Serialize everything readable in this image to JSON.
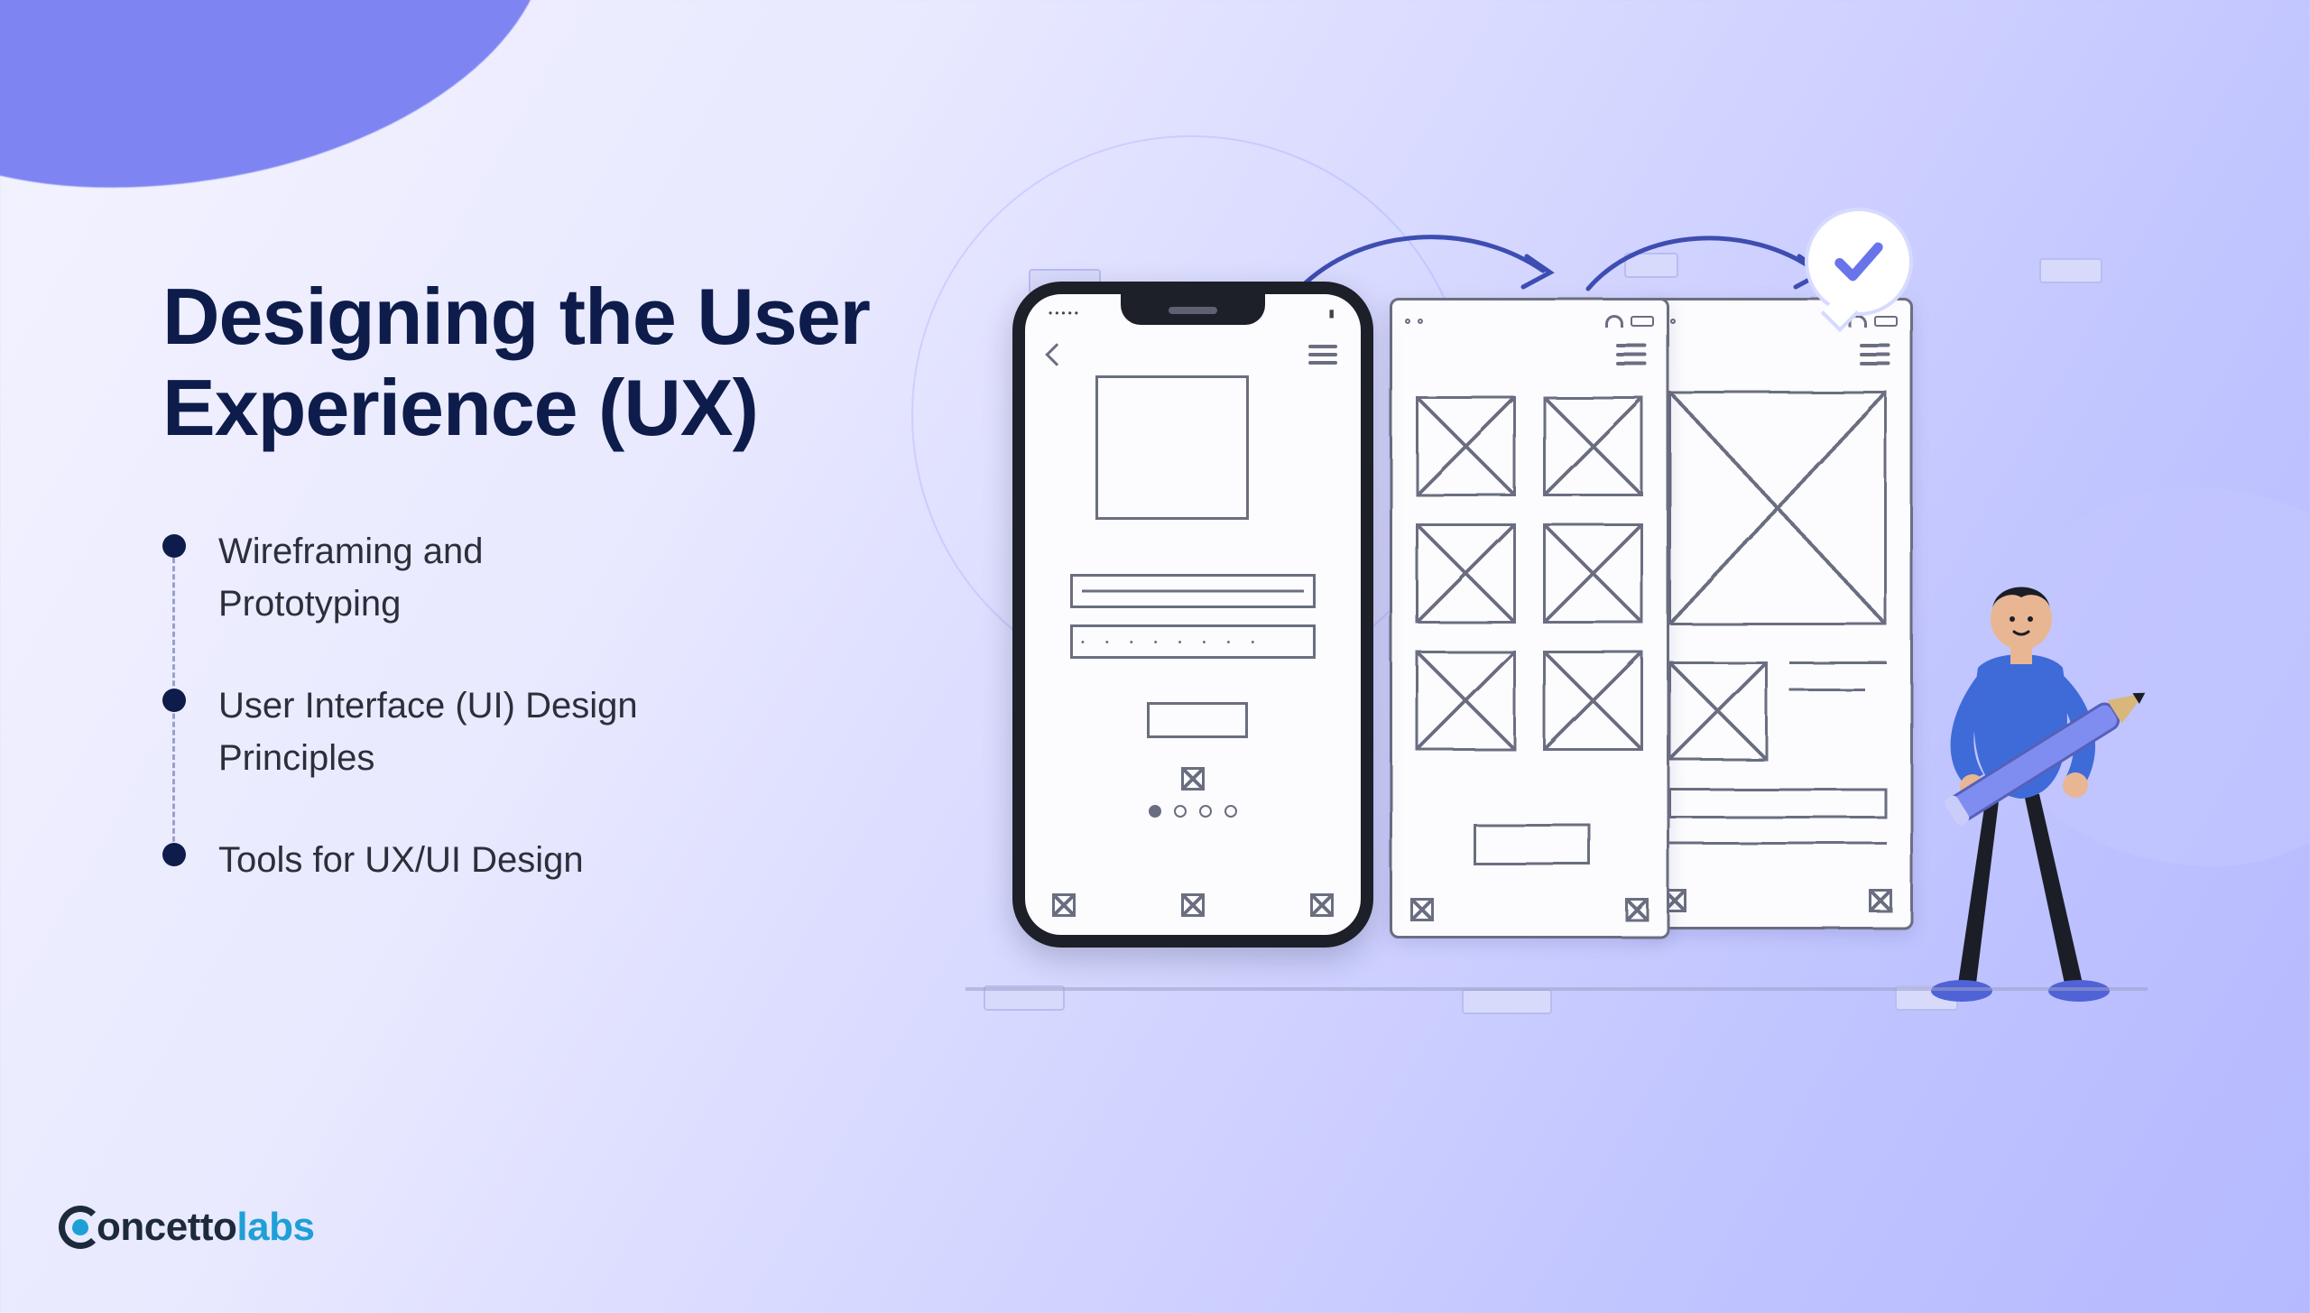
{
  "title": "Designing the User Experience (UX)",
  "bullets": [
    "Wireframing and Prototyping",
    "User Interface (UI) Design Principles",
    "Tools for UX/UI Design"
  ],
  "logo": {
    "word1": "oncetto",
    "word2": "labs"
  },
  "colors": {
    "heading": "#0d1c4b",
    "accent_arrow": "#3d4db2",
    "check": "#6a74ea",
    "logo_accent": "#1ea0d6"
  }
}
